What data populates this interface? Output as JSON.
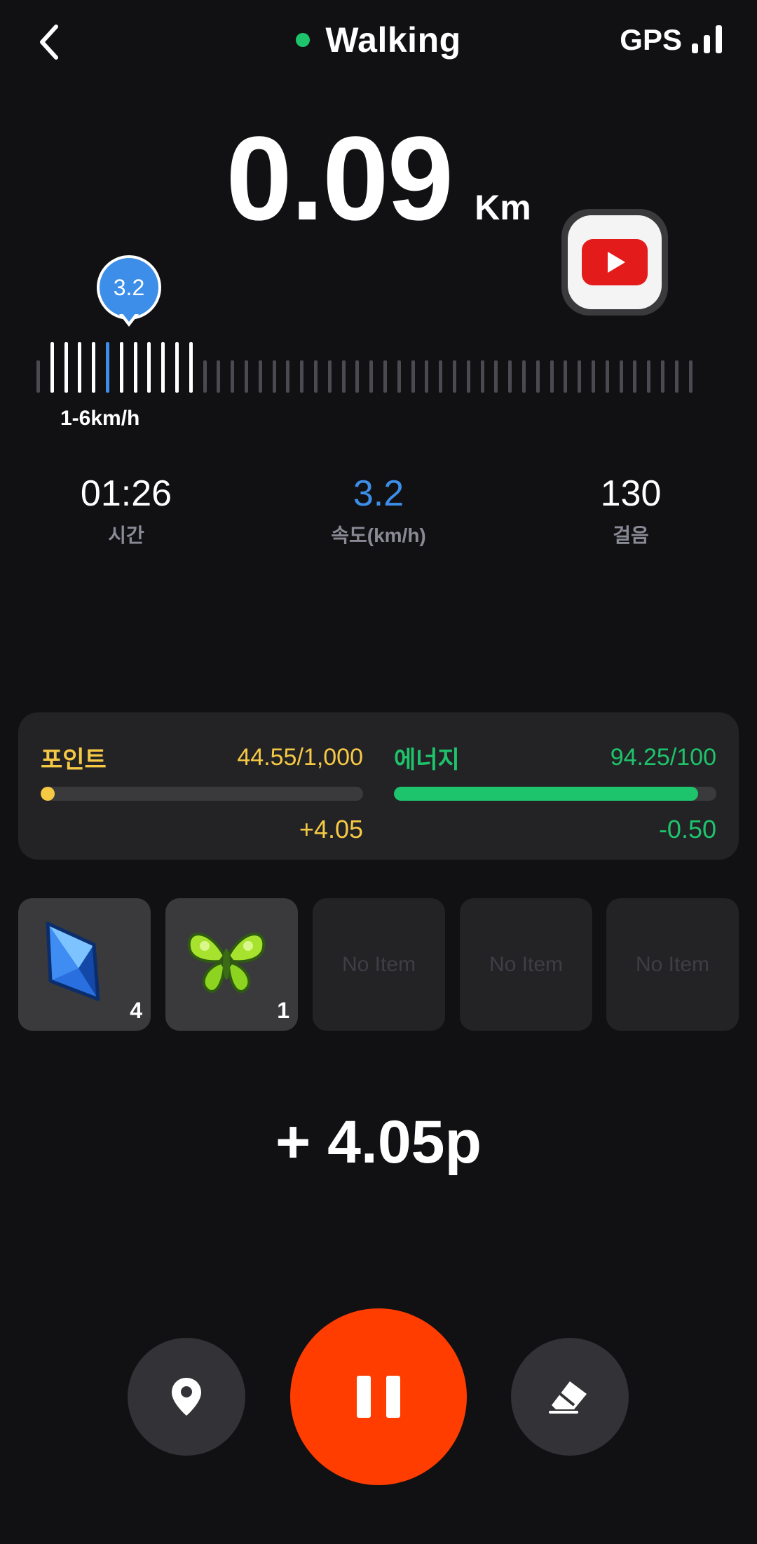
{
  "header": {
    "title": "Walking",
    "gps_label": "GPS",
    "status_color": "#1ec46b"
  },
  "distance": {
    "value": "0.09",
    "unit": "Km"
  },
  "speed_gauge": {
    "current": "3.2",
    "range_label": "1-6km/h",
    "active_color": "#3d8ee8"
  },
  "stats": [
    {
      "value": "01:26",
      "label": "시간"
    },
    {
      "value": "3.2",
      "label": "속도(km/h)"
    },
    {
      "value": "130",
      "label": "걸음"
    }
  ],
  "points": {
    "label": "포인트",
    "value": "44.55/1,000",
    "delta": "+4.05",
    "fraction": 0.04455,
    "color": "#f6c945"
  },
  "energy": {
    "label": "에너지",
    "value": "94.25/100",
    "delta": "-0.50",
    "fraction": 0.9425,
    "color": "#1ec46b"
  },
  "items": [
    {
      "icon": "blue-crystal-icon",
      "count": "4"
    },
    {
      "icon": "green-butterfly-icon",
      "count": "1"
    },
    {
      "label": "No Item"
    },
    {
      "label": "No Item"
    },
    {
      "label": "No Item"
    }
  ],
  "earned": "+ 4.05p",
  "controls": {
    "pause_color": "#ff3d00"
  }
}
